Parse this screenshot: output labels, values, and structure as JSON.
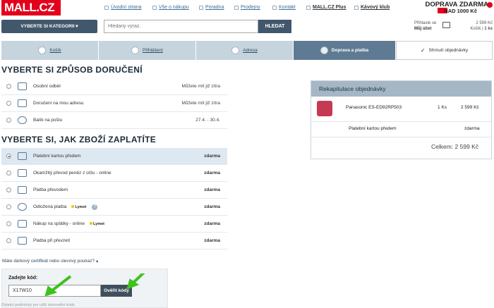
{
  "header": {
    "logo": "MALL.CZ",
    "links": [
      {
        "label": "Úvodní strana",
        "icon": "home-icon"
      },
      {
        "label": "Vše o nákupu",
        "icon": "info-icon"
      },
      {
        "label": "Poradna",
        "icon": "help-icon"
      },
      {
        "label": "Prodejny",
        "icon": "store-icon"
      },
      {
        "label": "Kontakt",
        "icon": "mail-icon"
      },
      {
        "label": "MALL.CZ Plus",
        "icon": "plus-icon"
      },
      {
        "label": "Kávový klub",
        "icon": "coffee-icon"
      }
    ],
    "promo_line1": "DOPRAVA ZDARMA",
    "promo_line2": "NAD 1000 Kč",
    "category_button": "VYBERTE SI KATEGORII ▾",
    "search_placeholder": "Hledaný výraz.",
    "search_button": "HLEDAT",
    "login_line1": "Přihlaste se",
    "login_line2": "Můj účet",
    "cart_price": "2 599 Kč",
    "cart_label": "Košík",
    "cart_count": "1 ks"
  },
  "steps": [
    {
      "label": "Košík",
      "icon": "cart-icon"
    },
    {
      "label": "Přihlášení",
      "icon": "pencil-icon"
    },
    {
      "label": "Adresa",
      "icon": "address-icon"
    },
    {
      "label": "Doprava a platba",
      "icon": "truck-icon"
    },
    {
      "label": "Shrnutí objednávky",
      "icon": "check-icon"
    }
  ],
  "delivery": {
    "title": "VYBERTE SI ZPŮSOB DORUČENÍ",
    "options": [
      {
        "label": "Osobní odběr",
        "right": "Můžete mít již zítra"
      },
      {
        "label": "Doručení na mou adresu",
        "right": "Můžete mít již zítra"
      },
      {
        "label": "Balík na poštu",
        "right": "27.4. - 30.4."
      }
    ]
  },
  "payment": {
    "title": "VYBERTE SI, JAK ZBOŽÍ ZAPLATÍTE",
    "options": [
      {
        "label": "Platební kartou předem",
        "right": "zdarma"
      },
      {
        "label": "Okamžitý převod peněz z účtu - online",
        "right": "zdarma"
      },
      {
        "label": "Platba převodem",
        "right": "zdarma"
      },
      {
        "label": "Odložená platba",
        "badge": "Lymet",
        "right": "zdarma"
      },
      {
        "label": "Nákup na splátky - online",
        "badge": "Lymet",
        "right": "zdarma"
      },
      {
        "label": "Platba při převzetí",
        "right": "zdarma"
      }
    ],
    "question_mark": "?"
  },
  "voucher": {
    "toggle": "Máte dárkový certifikát nebo slevový poukaz? ▴",
    "label": "Zadejte kód:",
    "value": "X17W10",
    "button": "Ověřit kódy"
  },
  "recap": {
    "title": "Rekapitulace objednávky",
    "product": "Panasonic ES-ED92RP503",
    "qty": "1 Ks",
    "price": "2 599 Kč",
    "payment": "Platební kartou předem",
    "payment_price": "zdarma",
    "total": "Celkem: 2 599 Kč"
  },
  "footnote": "Ostatní podmínky pro užití slevového kódu"
}
